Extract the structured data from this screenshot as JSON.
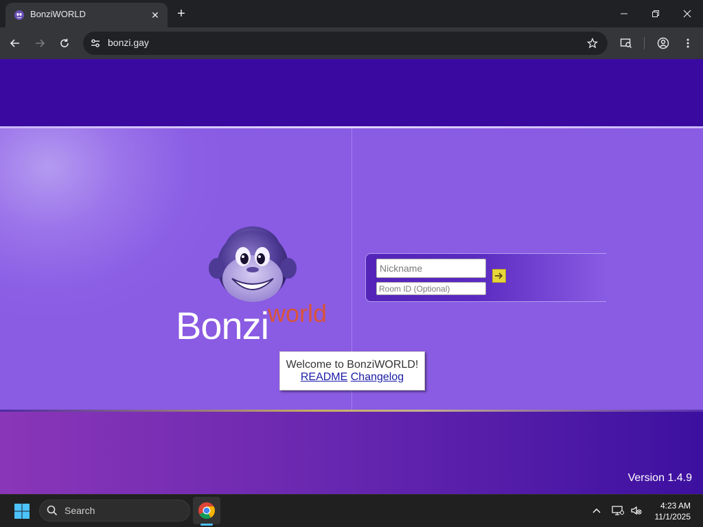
{
  "browser": {
    "tab_title": "BonziWORLD",
    "url": "bonzi.gay"
  },
  "page": {
    "logo_primary": "Bonzi",
    "logo_secondary": "world",
    "nickname_placeholder": "Nickname",
    "room_placeholder": "Room ID (Optional)",
    "welcome_text": "Welcome to BonziWORLD!",
    "readme_link": "README",
    "changelog_link": "Changelog",
    "version": "Version 1.4.9"
  },
  "taskbar": {
    "search_label": "Search",
    "time": "4:23 AM",
    "date": "11/1/2025"
  },
  "colors": {
    "top_band": "#3a0aa0",
    "mid_purple": "#8a5be3",
    "logo_world": "#d8533a",
    "go_button": "#e6d63a",
    "taskbar": "#202020"
  },
  "icons": [
    "bonzi-favicon-icon",
    "close-icon",
    "plus-icon",
    "minimize-icon",
    "restore-icon",
    "window-close-icon",
    "back-icon",
    "forward-icon",
    "reload-icon",
    "site-settings-icon",
    "bookmark-star-icon",
    "tab-search-icon",
    "profile-icon",
    "kebab-menu-icon",
    "arrow-right-icon",
    "windows-start-icon",
    "search-icon",
    "chrome-icon",
    "chevron-up-icon",
    "network-icon",
    "volume-muted-icon"
  ]
}
